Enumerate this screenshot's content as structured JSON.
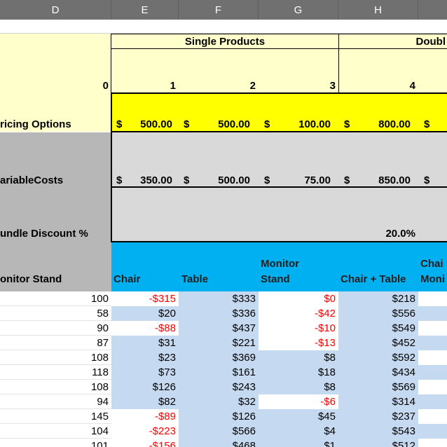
{
  "columns": [
    "D",
    "E",
    "F",
    "G",
    "H"
  ],
  "group_headers": {
    "single": "Single Products",
    "double": "Doubl"
  },
  "option_numbers": [
    "0",
    "1",
    "2",
    "3",
    "4"
  ],
  "rows": {
    "pricing_label": "ricing Options",
    "variable_label": "ariableCosts",
    "bundle_label": "undle Discount %",
    "bundle_value": "20.0%",
    "monitor_label": "onitor Stand"
  },
  "currency_symbol": "$",
  "pricing": [
    "500.00",
    "500.00",
    "100.00",
    "800.00"
  ],
  "variable_costs": [
    "350.00",
    "500.00",
    "75.00",
    "850.00"
  ],
  "table_headers": {
    "chair": "Chair",
    "table": "Table",
    "monitor_line1": "Monitor",
    "monitor_line2": "Stand",
    "chair_table": "Chair + Table",
    "partial_line1": "Chai",
    "partial_line2": "Moni"
  },
  "data_rows": [
    {
      "d": "100",
      "e": "-$315",
      "f": "$333",
      "g": "$0",
      "h": "$218"
    },
    {
      "d": "58",
      "e": "$20",
      "f": "$336",
      "g": "-$42",
      "h": "$556"
    },
    {
      "d": "90",
      "e": "-$88",
      "f": "$437",
      "g": "-$10",
      "h": "$549"
    },
    {
      "d": "87",
      "e": "$31",
      "f": "$221",
      "g": "-$13",
      "h": "$452"
    },
    {
      "d": "108",
      "e": "$23",
      "f": "$369",
      "g": "$8",
      "h": "$592"
    },
    {
      "d": "118",
      "e": "$73",
      "f": "$161",
      "g": "$18",
      "h": "$434"
    },
    {
      "d": "108",
      "e": "$126",
      "f": "$243",
      "g": "$8",
      "h": "$569"
    },
    {
      "d": "94",
      "e": "$82",
      "f": "$32",
      "g": "-$6",
      "h": "$314"
    },
    {
      "d": "145",
      "e": "-$89",
      "f": "$126",
      "g": "$45",
      "h": "$237"
    },
    {
      "d": "104",
      "e": "-$223",
      "f": "$566",
      "g": "$4",
      "h": "$543"
    },
    {
      "d": "101",
      "e": "-$156",
      "f": "$468",
      "g": "$1",
      "h": "$512"
    }
  ]
}
